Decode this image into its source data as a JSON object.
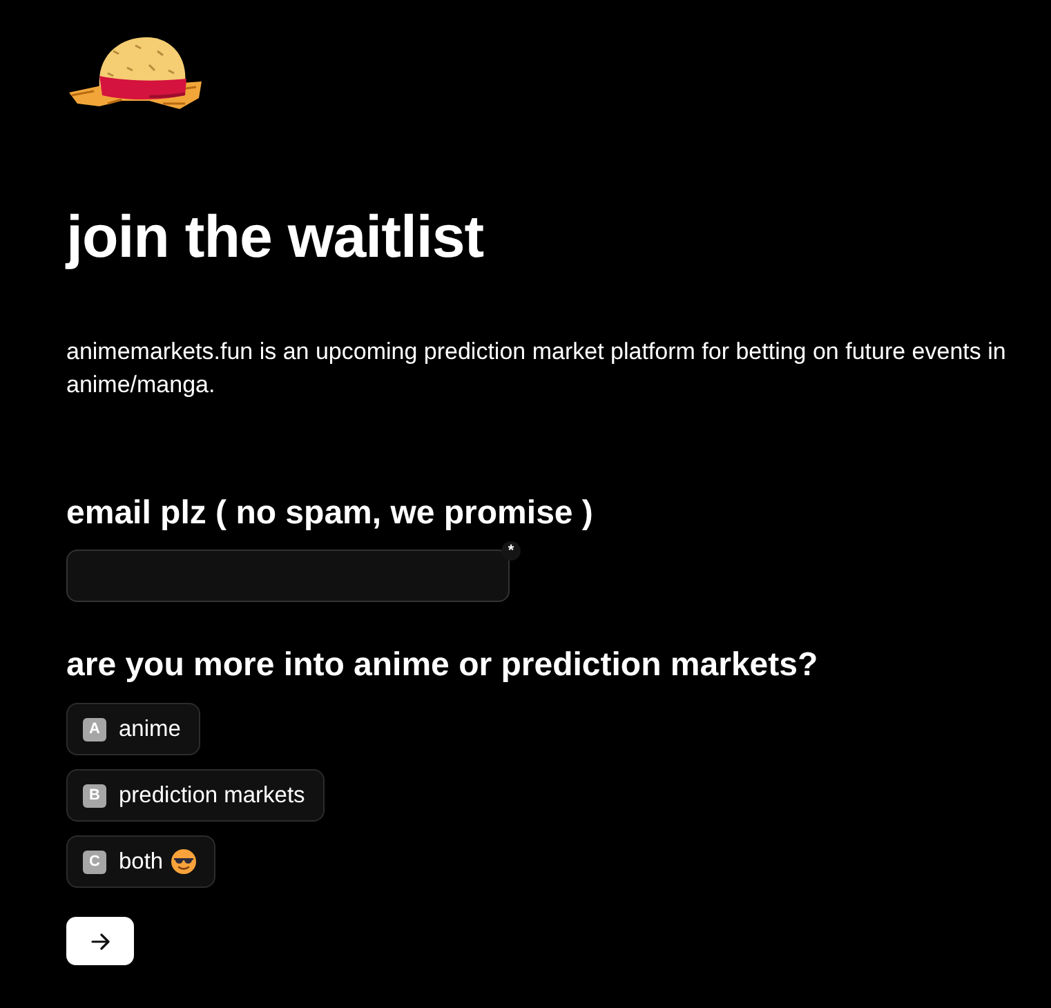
{
  "logo": {
    "kind": "straw-hat"
  },
  "title": "join the waitlist",
  "description": "animemarkets.fun is an upcoming prediction market platform for betting on future events in anime/manga.",
  "email_question": {
    "label": "email plz ( no spam, we promise )",
    "required_mark": "*"
  },
  "choice_question": {
    "label": "are you more into anime or prediction markets?",
    "options": [
      {
        "key": "A",
        "label": "anime",
        "selected": false,
        "emoji_icon": false
      },
      {
        "key": "B",
        "label": "prediction markets",
        "selected": false,
        "emoji_icon": false
      },
      {
        "key": "C",
        "label": "both",
        "selected": false,
        "emoji_icon": true
      }
    ]
  },
  "submit": {
    "kind": "arrow"
  }
}
